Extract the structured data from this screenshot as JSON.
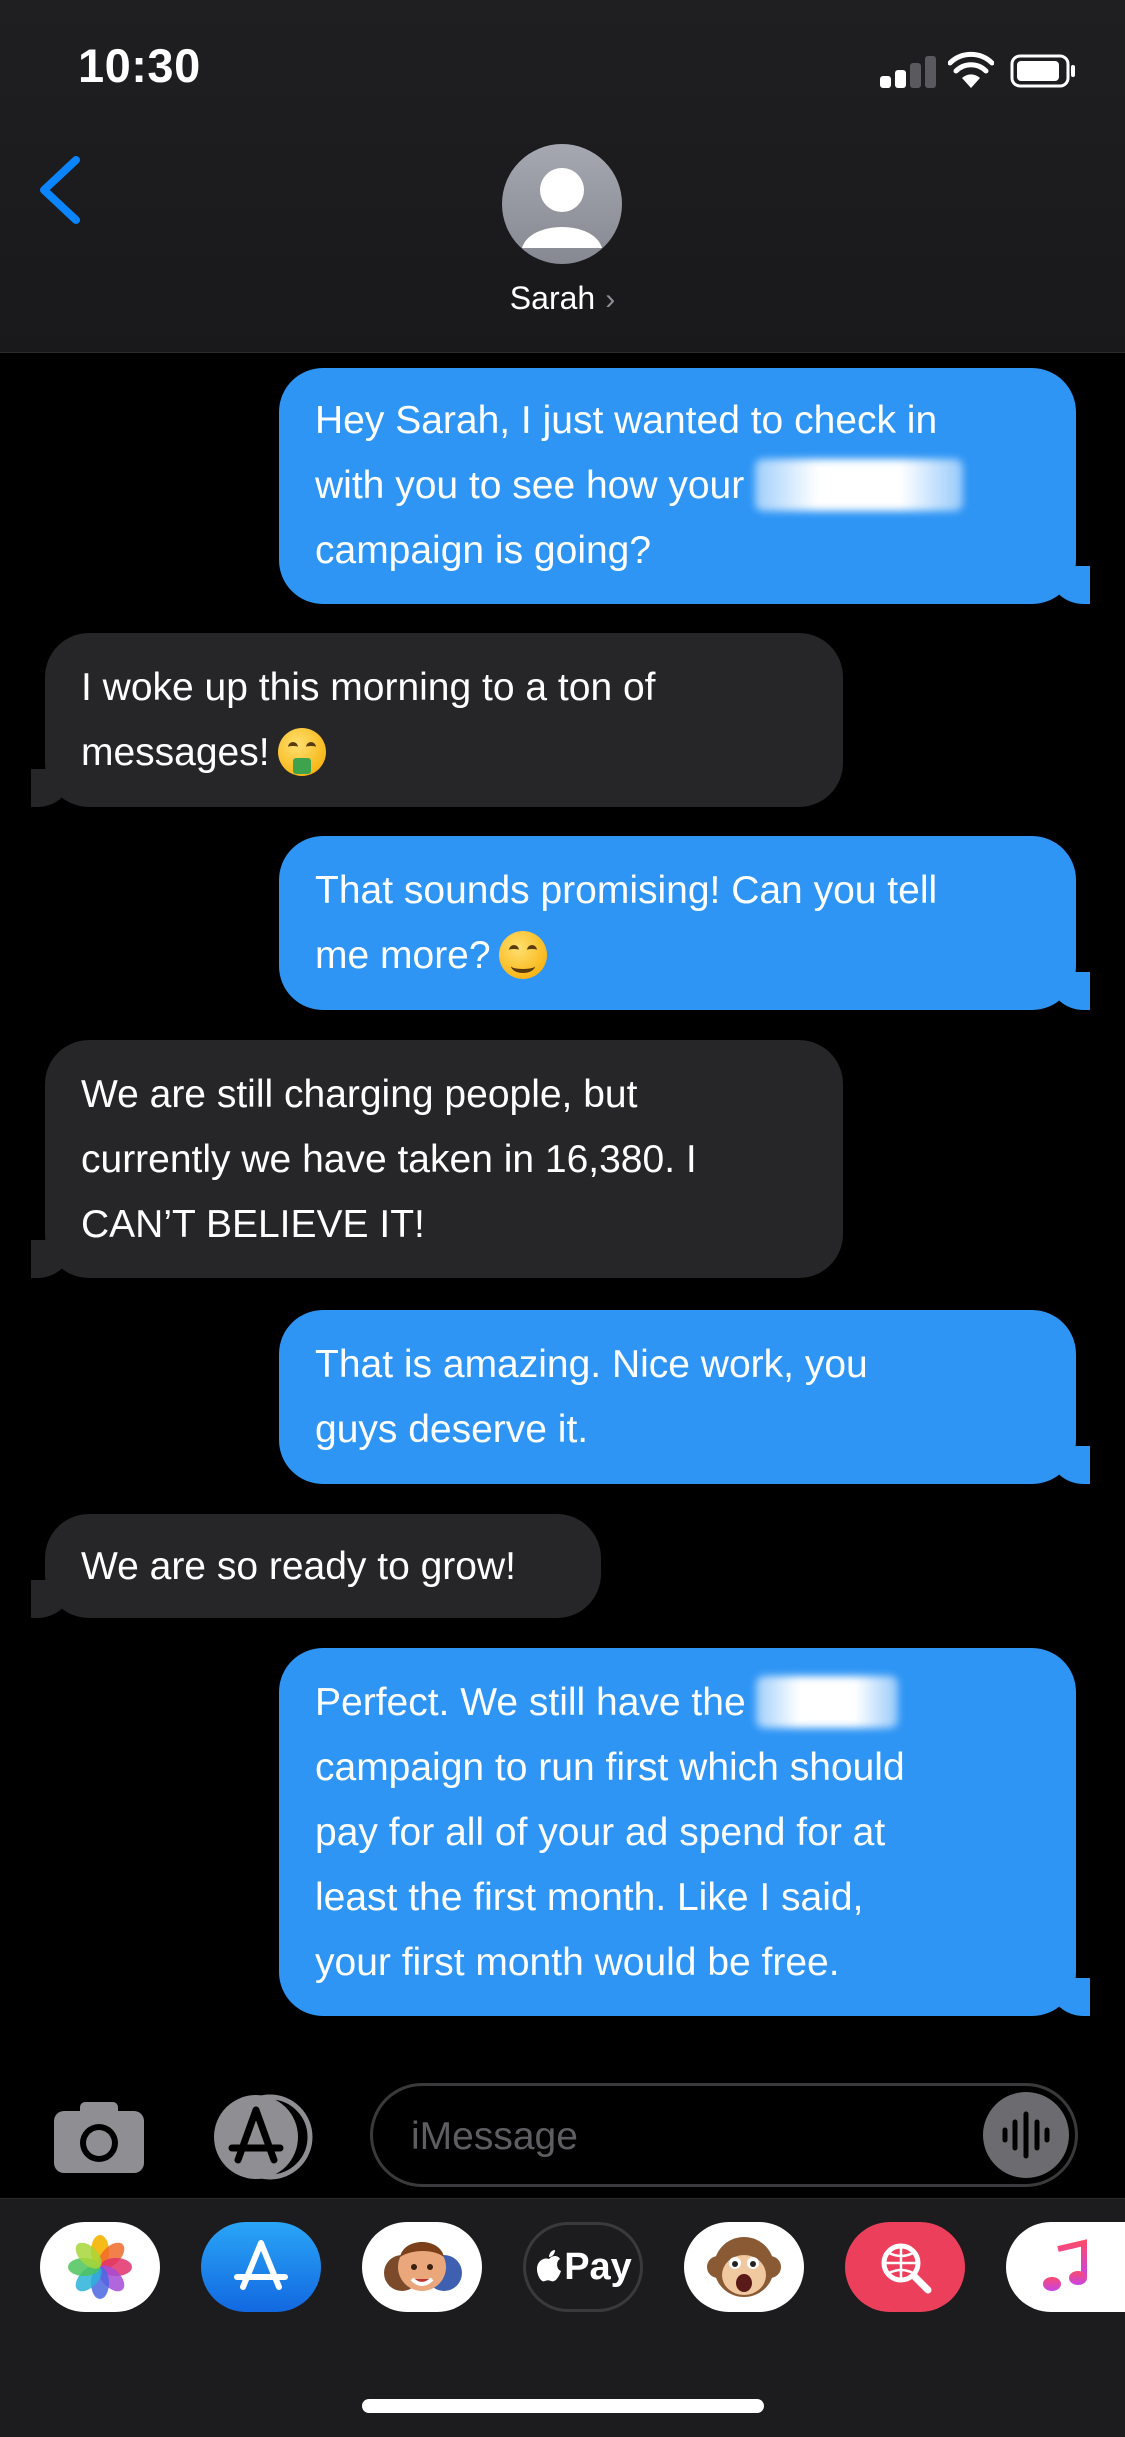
{
  "status_bar": {
    "time": "10:30"
  },
  "header": {
    "contact_name": "Sarah",
    "chevron": "›"
  },
  "messages": [
    {
      "direction": "outgoing",
      "lines": [
        "Hey Sarah, I just wanted to check in",
        "with you to see how your",
        "campaign is going?"
      ]
    },
    {
      "direction": "incoming",
      "lines": [
        "I woke up this morning to a ton of",
        "messages!"
      ],
      "emoji": "money-mouth-face"
    },
    {
      "direction": "outgoing",
      "lines": [
        "That sounds promising! Can you tell",
        "me more?"
      ],
      "emoji": "smiling-face"
    },
    {
      "direction": "incoming",
      "lines": [
        "We are still charging people, but",
        "currently we have taken in 16,380. I",
        "CAN’T BELIEVE IT!"
      ]
    },
    {
      "direction": "outgoing",
      "lines": [
        "That is amazing. Nice work, you",
        "guys deserve it."
      ]
    },
    {
      "direction": "incoming",
      "lines": [
        "We are so ready to grow!"
      ]
    },
    {
      "direction": "outgoing",
      "lines": [
        "Perfect. We still have the",
        "campaign to run first which should",
        "pay for all of your ad spend for at",
        "least the first month. Like I said,",
        "your first month would be free."
      ]
    }
  ],
  "input_bar": {
    "placeholder": "iMessage"
  },
  "app_drawer": {
    "apps": [
      "photos",
      "app-store",
      "memoji-stickers",
      "apple-pay",
      "animoji",
      "web-image-search",
      "music"
    ],
    "apple_pay_label": "Pay"
  },
  "colors": {
    "outgoing_bubble": "#2e95f5",
    "incoming_bubble": "#262628",
    "accent": "#0a84ff"
  }
}
